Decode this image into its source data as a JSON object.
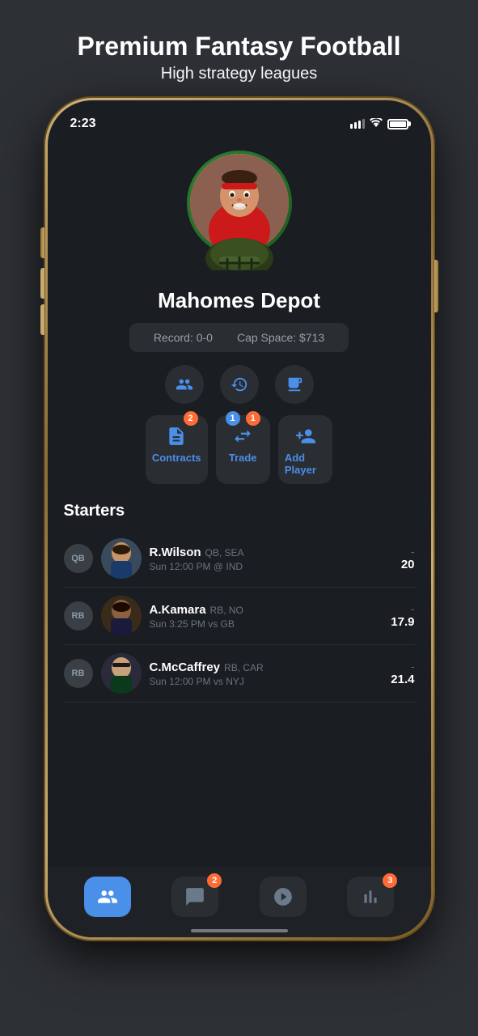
{
  "header": {
    "title": "Premium Fantasy Football",
    "subtitle": "High strategy leagues"
  },
  "statusBar": {
    "time": "2:23",
    "battery": 100
  },
  "team": {
    "name": "Mahomes Depot",
    "record": "Record: 0-0",
    "capSpace": "Cap Space: $713"
  },
  "quickActions": [
    {
      "id": "roster",
      "icon": "people"
    },
    {
      "id": "history",
      "icon": "history"
    },
    {
      "id": "news",
      "icon": "news"
    }
  ],
  "actionButtons": [
    {
      "id": "contracts",
      "label": "Contracts",
      "badge": "2",
      "badgeColor": "orange"
    },
    {
      "id": "trade",
      "label": "Trade",
      "badgeLeft": "1",
      "badgeRight": "1",
      "badgeColor": "blue"
    },
    {
      "id": "add-player",
      "label": "Add Player"
    }
  ],
  "starters": {
    "title": "Starters",
    "players": [
      {
        "position": "QB",
        "name": "R.Wilson",
        "posTeam": "QB, SEA",
        "game": "Sun 12:00 PM @ IND",
        "scoreDash": "-",
        "score": "20"
      },
      {
        "position": "RB",
        "name": "A.Kamara",
        "posTeam": "RB, NO",
        "game": "Sun 3:25 PM vs GB",
        "scoreDash": "-",
        "score": "17.9"
      },
      {
        "position": "RB",
        "name": "C.McCaffrey",
        "posTeam": "RB, CAR",
        "game": "Sun 12:00 PM vs NYJ",
        "scoreDash": "-",
        "score": "21.4"
      }
    ]
  },
  "bottomNav": [
    {
      "id": "roster",
      "active": true,
      "badge": null
    },
    {
      "id": "chat",
      "active": false,
      "badge": "2"
    },
    {
      "id": "scores",
      "active": false,
      "badge": null
    },
    {
      "id": "standings",
      "active": false,
      "badge": "3"
    }
  ]
}
